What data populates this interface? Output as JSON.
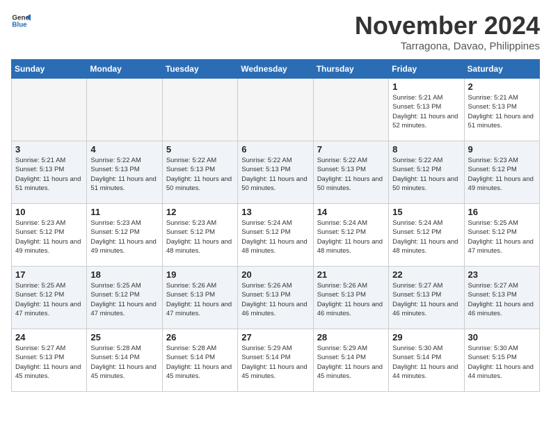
{
  "header": {
    "logo_general": "General",
    "logo_blue": "Blue",
    "month_title": "November 2024",
    "location": "Tarragona, Davao, Philippines"
  },
  "weekdays": [
    "Sunday",
    "Monday",
    "Tuesday",
    "Wednesday",
    "Thursday",
    "Friday",
    "Saturday"
  ],
  "weeks": [
    [
      {
        "day": "",
        "sunrise": "",
        "sunset": "",
        "daylight": "",
        "empty": true
      },
      {
        "day": "",
        "sunrise": "",
        "sunset": "",
        "daylight": "",
        "empty": true
      },
      {
        "day": "",
        "sunrise": "",
        "sunset": "",
        "daylight": "",
        "empty": true
      },
      {
        "day": "",
        "sunrise": "",
        "sunset": "",
        "daylight": "",
        "empty": true
      },
      {
        "day": "",
        "sunrise": "",
        "sunset": "",
        "daylight": "",
        "empty": true
      },
      {
        "day": "1",
        "sunrise": "Sunrise: 5:21 AM",
        "sunset": "Sunset: 5:13 PM",
        "daylight": "Daylight: 11 hours and 52 minutes.",
        "empty": false
      },
      {
        "day": "2",
        "sunrise": "Sunrise: 5:21 AM",
        "sunset": "Sunset: 5:13 PM",
        "daylight": "Daylight: 11 hours and 51 minutes.",
        "empty": false
      }
    ],
    [
      {
        "day": "3",
        "sunrise": "Sunrise: 5:21 AM",
        "sunset": "Sunset: 5:13 PM",
        "daylight": "Daylight: 11 hours and 51 minutes.",
        "empty": false
      },
      {
        "day": "4",
        "sunrise": "Sunrise: 5:22 AM",
        "sunset": "Sunset: 5:13 PM",
        "daylight": "Daylight: 11 hours and 51 minutes.",
        "empty": false
      },
      {
        "day": "5",
        "sunrise": "Sunrise: 5:22 AM",
        "sunset": "Sunset: 5:13 PM",
        "daylight": "Daylight: 11 hours and 50 minutes.",
        "empty": false
      },
      {
        "day": "6",
        "sunrise": "Sunrise: 5:22 AM",
        "sunset": "Sunset: 5:13 PM",
        "daylight": "Daylight: 11 hours and 50 minutes.",
        "empty": false
      },
      {
        "day": "7",
        "sunrise": "Sunrise: 5:22 AM",
        "sunset": "Sunset: 5:13 PM",
        "daylight": "Daylight: 11 hours and 50 minutes.",
        "empty": false
      },
      {
        "day": "8",
        "sunrise": "Sunrise: 5:22 AM",
        "sunset": "Sunset: 5:12 PM",
        "daylight": "Daylight: 11 hours and 50 minutes.",
        "empty": false
      },
      {
        "day": "9",
        "sunrise": "Sunrise: 5:23 AM",
        "sunset": "Sunset: 5:12 PM",
        "daylight": "Daylight: 11 hours and 49 minutes.",
        "empty": false
      }
    ],
    [
      {
        "day": "10",
        "sunrise": "Sunrise: 5:23 AM",
        "sunset": "Sunset: 5:12 PM",
        "daylight": "Daylight: 11 hours and 49 minutes.",
        "empty": false
      },
      {
        "day": "11",
        "sunrise": "Sunrise: 5:23 AM",
        "sunset": "Sunset: 5:12 PM",
        "daylight": "Daylight: 11 hours and 49 minutes.",
        "empty": false
      },
      {
        "day": "12",
        "sunrise": "Sunrise: 5:23 AM",
        "sunset": "Sunset: 5:12 PM",
        "daylight": "Daylight: 11 hours and 48 minutes.",
        "empty": false
      },
      {
        "day": "13",
        "sunrise": "Sunrise: 5:24 AM",
        "sunset": "Sunset: 5:12 PM",
        "daylight": "Daylight: 11 hours and 48 minutes.",
        "empty": false
      },
      {
        "day": "14",
        "sunrise": "Sunrise: 5:24 AM",
        "sunset": "Sunset: 5:12 PM",
        "daylight": "Daylight: 11 hours and 48 minutes.",
        "empty": false
      },
      {
        "day": "15",
        "sunrise": "Sunrise: 5:24 AM",
        "sunset": "Sunset: 5:12 PM",
        "daylight": "Daylight: 11 hours and 48 minutes.",
        "empty": false
      },
      {
        "day": "16",
        "sunrise": "Sunrise: 5:25 AM",
        "sunset": "Sunset: 5:12 PM",
        "daylight": "Daylight: 11 hours and 47 minutes.",
        "empty": false
      }
    ],
    [
      {
        "day": "17",
        "sunrise": "Sunrise: 5:25 AM",
        "sunset": "Sunset: 5:12 PM",
        "daylight": "Daylight: 11 hours and 47 minutes.",
        "empty": false
      },
      {
        "day": "18",
        "sunrise": "Sunrise: 5:25 AM",
        "sunset": "Sunset: 5:12 PM",
        "daylight": "Daylight: 11 hours and 47 minutes.",
        "empty": false
      },
      {
        "day": "19",
        "sunrise": "Sunrise: 5:26 AM",
        "sunset": "Sunset: 5:13 PM",
        "daylight": "Daylight: 11 hours and 47 minutes.",
        "empty": false
      },
      {
        "day": "20",
        "sunrise": "Sunrise: 5:26 AM",
        "sunset": "Sunset: 5:13 PM",
        "daylight": "Daylight: 11 hours and 46 minutes.",
        "empty": false
      },
      {
        "day": "21",
        "sunrise": "Sunrise: 5:26 AM",
        "sunset": "Sunset: 5:13 PM",
        "daylight": "Daylight: 11 hours and 46 minutes.",
        "empty": false
      },
      {
        "day": "22",
        "sunrise": "Sunrise: 5:27 AM",
        "sunset": "Sunset: 5:13 PM",
        "daylight": "Daylight: 11 hours and 46 minutes.",
        "empty": false
      },
      {
        "day": "23",
        "sunrise": "Sunrise: 5:27 AM",
        "sunset": "Sunset: 5:13 PM",
        "daylight": "Daylight: 11 hours and 46 minutes.",
        "empty": false
      }
    ],
    [
      {
        "day": "24",
        "sunrise": "Sunrise: 5:27 AM",
        "sunset": "Sunset: 5:13 PM",
        "daylight": "Daylight: 11 hours and 45 minutes.",
        "empty": false
      },
      {
        "day": "25",
        "sunrise": "Sunrise: 5:28 AM",
        "sunset": "Sunset: 5:14 PM",
        "daylight": "Daylight: 11 hours and 45 minutes.",
        "empty": false
      },
      {
        "day": "26",
        "sunrise": "Sunrise: 5:28 AM",
        "sunset": "Sunset: 5:14 PM",
        "daylight": "Daylight: 11 hours and 45 minutes.",
        "empty": false
      },
      {
        "day": "27",
        "sunrise": "Sunrise: 5:29 AM",
        "sunset": "Sunset: 5:14 PM",
        "daylight": "Daylight: 11 hours and 45 minutes.",
        "empty": false
      },
      {
        "day": "28",
        "sunrise": "Sunrise: 5:29 AM",
        "sunset": "Sunset: 5:14 PM",
        "daylight": "Daylight: 11 hours and 45 minutes.",
        "empty": false
      },
      {
        "day": "29",
        "sunrise": "Sunrise: 5:30 AM",
        "sunset": "Sunset: 5:14 PM",
        "daylight": "Daylight: 11 hours and 44 minutes.",
        "empty": false
      },
      {
        "day": "30",
        "sunrise": "Sunrise: 5:30 AM",
        "sunset": "Sunset: 5:15 PM",
        "daylight": "Daylight: 11 hours and 44 minutes.",
        "empty": false
      }
    ]
  ]
}
